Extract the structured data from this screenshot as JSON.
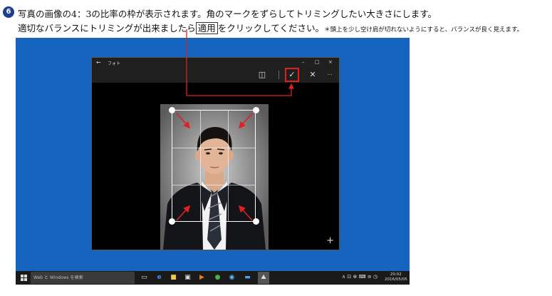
{
  "instructions": {
    "step_number": "6",
    "line1": "写真の画像の4：3の比率の枠が表示されます。角のマークをずらしてトリミングしたい大きさにします。",
    "line2_before": "適切なバランスにトリミングが出来ましたら",
    "line2_button": "適用",
    "line2_after": "をクリックしてください。",
    "line2_note": "＊頭上を少し空け肩が切れないようにすると、バランスが良く見えます。"
  },
  "window": {
    "back": "←",
    "title": "フォト",
    "minimize": "–",
    "maximize": "□",
    "close": "×",
    "toolbar": {
      "aspect": "◫",
      "apply": "✓",
      "cancel": "✕",
      "more": "···"
    },
    "add": "+"
  },
  "taskbar": {
    "search_placeholder": "Web と Windows を検索",
    "tray_icons": "∧ ⊡ ⊕ ⌨ ≡ ◷",
    "time": "20:02",
    "date": "2016/05/05"
  },
  "colors": {
    "desktop": "#1565c0",
    "annotation": "#e02020",
    "badge": "#1e3f8f"
  }
}
